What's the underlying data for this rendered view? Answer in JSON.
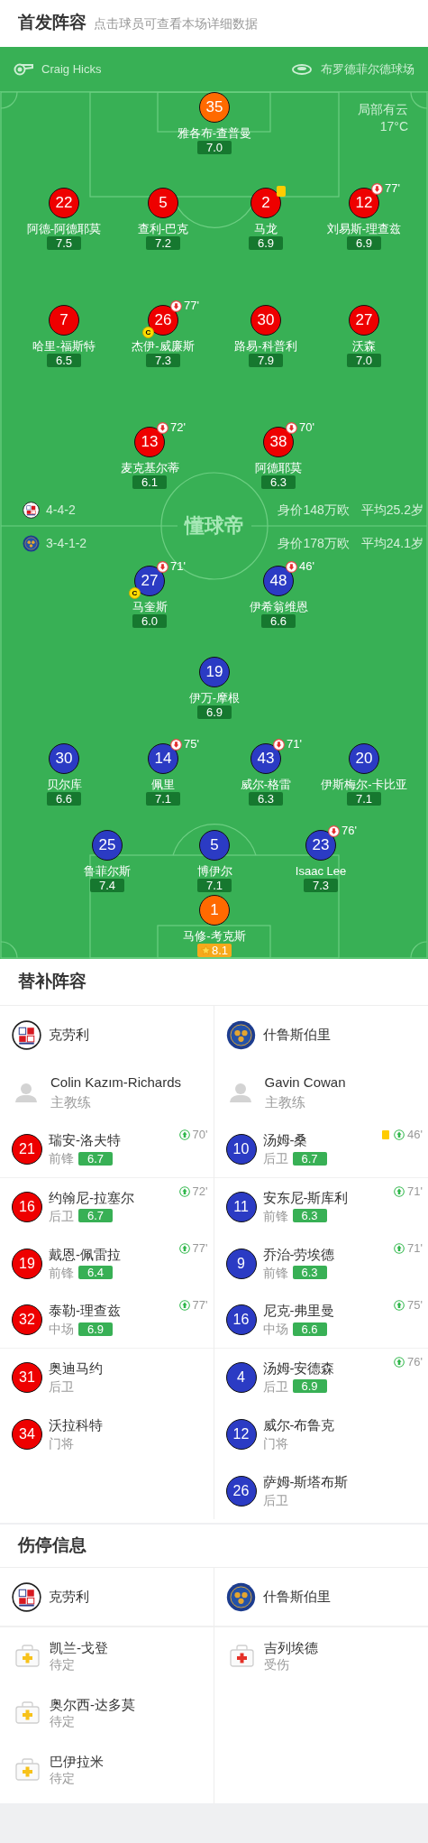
{
  "header": {
    "title": "首发阵容",
    "hint": "点击球员可查看本场详细数据"
  },
  "match_info": {
    "referee": "Craig Hicks",
    "stadium": "布罗德菲尔德球场",
    "weather": "局部有云",
    "temperature": "17°C"
  },
  "pitch_logo": "懂球帝",
  "home": {
    "formation": "4-4-2",
    "market_value": "身价148万欧",
    "average_age": "平均25.2岁",
    "lines": [
      [
        {
          "number": "35",
          "name": "雅各布-查普曼",
          "rating": "7.0",
          "kind": "goalkeeper",
          "yellow_card": false,
          "best": false
        }
      ],
      [
        {
          "number": "22",
          "name": "阿德-阿德耶莫",
          "rating": "7.5",
          "kind": "outfield",
          "yellow_card": false,
          "best": false
        },
        {
          "number": "5",
          "name": "查利-巴克",
          "rating": "7.2",
          "kind": "outfield",
          "yellow_card": false,
          "best": false
        },
        {
          "number": "2",
          "name": "马龙",
          "rating": "6.9",
          "kind": "outfield",
          "yellow_card": true,
          "best": false
        },
        {
          "number": "12",
          "name": "刘易斯-理查兹",
          "rating": "6.9",
          "kind": "outfield",
          "yellow_card": false,
          "best": false,
          "sub_out": "77'"
        }
      ],
      [
        {
          "number": "7",
          "name": "哈里-福斯特",
          "rating": "6.5",
          "kind": "outfield",
          "yellow_card": false,
          "best": false
        },
        {
          "number": "26",
          "name": "杰伊-威廉斯",
          "rating": "7.3",
          "kind": "outfield",
          "yellow_card": false,
          "best": false,
          "sub_out": "77'",
          "captain_badge": "C"
        },
        {
          "number": "30",
          "name": "路易-科普利",
          "rating": "7.9",
          "kind": "outfield",
          "yellow_card": false,
          "best": false
        },
        {
          "number": "27",
          "name": "沃森",
          "rating": "7.0",
          "kind": "outfield",
          "yellow_card": false,
          "best": false
        }
      ],
      [
        {
          "number": "13",
          "name": "麦克基尔蒂",
          "rating": "6.1",
          "kind": "outfield",
          "yellow_card": false,
          "best": false,
          "sub_out": "72'"
        },
        {
          "number": "38",
          "name": "阿德耶莫",
          "rating": "6.3",
          "kind": "outfield",
          "yellow_card": false,
          "best": false,
          "sub_out": "70'"
        }
      ]
    ]
  },
  "away": {
    "formation": "3-4-1-2",
    "market_value": "身价178万欧",
    "average_age": "平均24.1岁",
    "lines": [
      [
        {
          "number": "27",
          "name": "马奎斯",
          "rating": "6.0",
          "kind": "outfield",
          "yellow_card": false,
          "best": false,
          "sub_out": "71'",
          "captain_badge": "C"
        },
        {
          "number": "48",
          "name": "伊希翁维恩",
          "rating": "6.6",
          "kind": "outfield",
          "yellow_card": false,
          "best": false,
          "sub_out": "46'"
        }
      ],
      [
        {
          "number": "19",
          "name": "伊万-摩根",
          "rating": "6.9",
          "kind": "outfield",
          "yellow_card": false,
          "best": false
        }
      ],
      [
        {
          "number": "30",
          "name": "贝尔库",
          "rating": "6.6",
          "kind": "outfield",
          "yellow_card": false,
          "best": false
        },
        {
          "number": "14",
          "name": "佩里",
          "rating": "7.1",
          "kind": "outfield",
          "yellow_card": false,
          "best": false,
          "sub_out": "75'"
        },
        {
          "number": "43",
          "name": "威尔-格雷",
          "rating": "6.3",
          "kind": "outfield",
          "yellow_card": false,
          "best": false,
          "sub_out": "71'"
        },
        {
          "number": "20",
          "name": "伊斯梅尔-卡比亚",
          "rating": "7.1",
          "kind": "outfield",
          "yellow_card": false,
          "best": false
        }
      ],
      [
        {
          "number": "25",
          "name": "鲁菲尔斯",
          "rating": "7.4",
          "kind": "outfield",
          "yellow_card": false,
          "best": false
        },
        {
          "number": "5",
          "name": "博伊尔",
          "rating": "7.1",
          "kind": "outfield",
          "yellow_card": false,
          "best": false
        },
        {
          "number": "23",
          "name": "Isaac Lee",
          "rating": "7.3",
          "kind": "outfield",
          "yellow_card": false,
          "best": false,
          "sub_out": "76'"
        }
      ],
      [
        {
          "number": "1",
          "name": "马修-考克斯",
          "rating": "8.1",
          "kind": "goalkeeper",
          "yellow_card": false,
          "best": true
        }
      ]
    ]
  },
  "substitutes": {
    "title": "替补阵容",
    "teams": [
      {
        "name": "克劳利",
        "coach": {
          "name": "Colin Kazım-Richards",
          "role": "主教练"
        },
        "players": [
          {
            "number": "21",
            "name": "瑞安-洛夫特",
            "position": "前锋",
            "rating": "6.7",
            "sub_in": "70'",
            "yellow_card": false
          },
          {
            "number": "16",
            "name": "约翰尼-拉塞尔",
            "position": "后卫",
            "rating": "6.7",
            "sub_in": "72'",
            "yellow_card": false
          },
          {
            "number": "19",
            "name": "戴恩-佩雷拉",
            "position": "前锋",
            "rating": "6.4",
            "sub_in": "77'",
            "yellow_card": false
          },
          {
            "number": "32",
            "name": "泰勒-理查兹",
            "position": "中场",
            "rating": "6.9",
            "sub_in": "77'",
            "yellow_card": false
          },
          {
            "number": "31",
            "name": "奥迪马约",
            "position": "后卫",
            "yellow_card": false
          },
          {
            "number": "34",
            "name": "沃拉科特",
            "position": "门将",
            "yellow_card": false
          }
        ]
      },
      {
        "name": "什鲁斯伯里",
        "coach": {
          "name": "Gavin Cowan",
          "role": "主教练"
        },
        "players": [
          {
            "number": "10",
            "name": "汤姆-桑",
            "position": "后卫",
            "rating": "6.7",
            "sub_in": "46'",
            "yellow_card": true
          },
          {
            "number": "11",
            "name": "安东尼-斯库利",
            "position": "前锋",
            "rating": "6.3",
            "sub_in": "71'",
            "yellow_card": false
          },
          {
            "number": "9",
            "name": "乔治-劳埃德",
            "position": "前锋",
            "rating": "6.3",
            "sub_in": "71'",
            "yellow_card": false
          },
          {
            "number": "16",
            "name": "尼克-弗里曼",
            "position": "中场",
            "rating": "6.6",
            "sub_in": "75'",
            "yellow_card": false
          },
          {
            "number": "4",
            "name": "汤姆-安德森",
            "position": "后卫",
            "rating": "6.9",
            "sub_in": "76'",
            "yellow_card": false
          },
          {
            "number": "12",
            "name": "威尔-布鲁克",
            "position": "门将",
            "yellow_card": false
          },
          {
            "number": "26",
            "name": "萨姆-斯塔布斯",
            "position": "后卫",
            "yellow_card": false
          }
        ]
      }
    ]
  },
  "injuries": {
    "title": "伤停信息",
    "teams": [
      {
        "name": "克劳利",
        "players": [
          {
            "name": "凯兰-戈登",
            "status": "待定",
            "kind": "doubtful"
          },
          {
            "name": "奥尔西-达多莫",
            "status": "待定",
            "kind": "doubtful"
          },
          {
            "name": "巴伊拉米",
            "status": "待定",
            "kind": "doubtful"
          }
        ]
      },
      {
        "name": "什鲁斯伯里",
        "players": [
          {
            "name": "吉列埃德",
            "status": "受伤",
            "kind": "injured"
          }
        ]
      }
    ]
  }
}
